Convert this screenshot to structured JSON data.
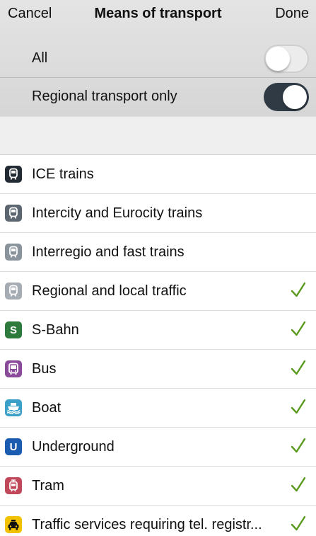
{
  "navbar": {
    "cancel_label": "Cancel",
    "title": "Means of transport",
    "done_label": "Done"
  },
  "toggles": {
    "all": {
      "label": "All",
      "on": false
    },
    "regional": {
      "label": "Regional transport only",
      "on": true
    }
  },
  "colors": {
    "switch_on": "#2f3a45",
    "check": "#5a9a1e"
  },
  "transport": [
    {
      "label": "ICE trains",
      "icon": "ice-train-icon",
      "icon_color": "#222a33",
      "glyph": "",
      "checked": false
    },
    {
      "label": "Intercity and Eurocity trains",
      "icon": "intercity-train-icon",
      "icon_color": "#5c6670",
      "glyph": "",
      "checked": false
    },
    {
      "label": "Interregio and fast trains",
      "icon": "interregio-train-icon",
      "icon_color": "#8a949c",
      "glyph": "",
      "checked": false
    },
    {
      "label": "Regional and local traffic",
      "icon": "regional-train-icon",
      "icon_color": "#a5acb3",
      "glyph": "",
      "checked": true
    },
    {
      "label": "S-Bahn",
      "icon": "s-bahn-icon",
      "icon_color": "#2e7a3c",
      "glyph": "S",
      "checked": true
    },
    {
      "label": "Bus",
      "icon": "bus-icon",
      "icon_color": "#8a4a9a",
      "glyph": "",
      "checked": true
    },
    {
      "label": "Boat",
      "icon": "boat-icon",
      "icon_color": "#3aa0c8",
      "glyph": "",
      "checked": true
    },
    {
      "label": "Underground",
      "icon": "underground-icon",
      "icon_color": "#1c5cb0",
      "glyph": "U",
      "checked": true
    },
    {
      "label": "Tram",
      "icon": "tram-icon",
      "icon_color": "#c0485a",
      "glyph": "",
      "checked": true
    },
    {
      "label": "Traffic services requiring tel. registr...",
      "icon": "taxi-icon",
      "icon_color": "#f2c200",
      "glyph": "",
      "checked": true
    }
  ]
}
